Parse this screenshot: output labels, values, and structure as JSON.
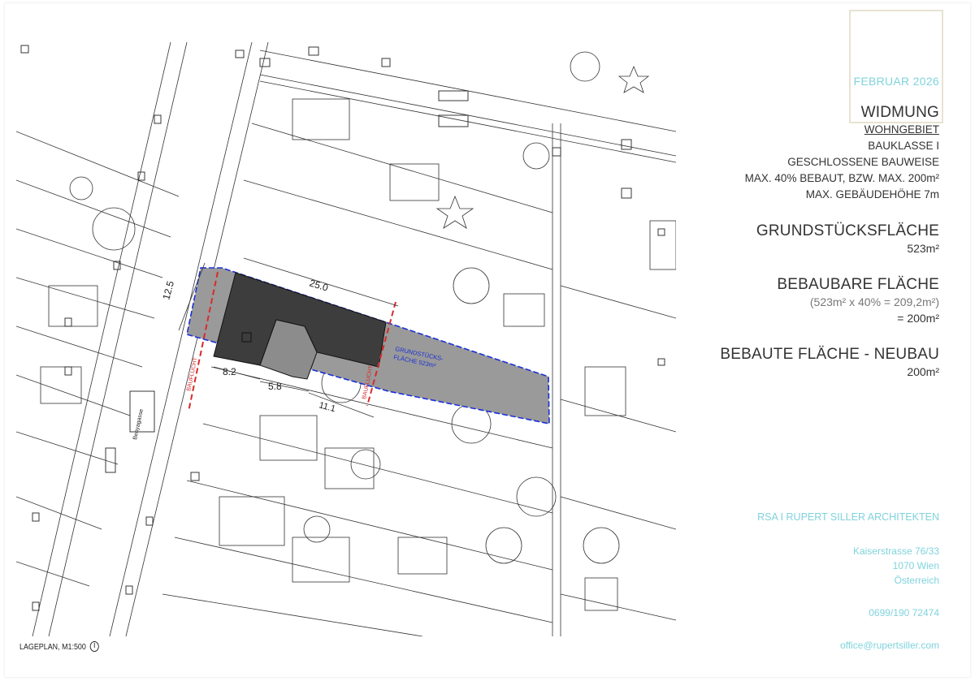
{
  "date": "FEBRUAR 2026",
  "widmung": {
    "heading": "WIDMUNG",
    "lines": [
      "WOHNGEBIET",
      "BAUKLASSE I",
      "GESCHLOSSENE BAUWEISE",
      "MAX. 40% BEBAUT, BZW. MAX. 200m²",
      "MAX. GEBÄUDEHÖHE 7m"
    ]
  },
  "grundstueck": {
    "heading": "GRUNDSTÜCKSFLÄCHE",
    "value": "523m²"
  },
  "bebaubar": {
    "heading": "BEBAUBARE FLÄCHE",
    "calc": "(523m² x 40% = 209,2m²)",
    "value": "= 200m²"
  },
  "bebaut": {
    "heading": "BEBAUTE FLÄCHE - NEUBAU",
    "value": "200m²"
  },
  "studio": {
    "name": "RSA I RUPERT SILLER ARCHITEKTEN",
    "street": "Kaiserstrasse 76/33",
    "city": "1070 Wien",
    "country": "Österreich",
    "phone": "0699/190 72474",
    "email": "office@rupertsiller.com"
  },
  "plan": {
    "caption": "LAGEPLAN, M1:500",
    "dim_top": "25.0",
    "dim_side": "12.5",
    "dim_a": "8.2",
    "dim_b": "5.8",
    "dim_c": "11.1",
    "baufl_1": "BAUFLUCHT",
    "baufl_2": "BAUFLUCHT",
    "plot_label_1": "GRUNDSTÜCKS-",
    "plot_label_2": "FLÄCHE 523m²",
    "street_name": "Benyagasse"
  }
}
